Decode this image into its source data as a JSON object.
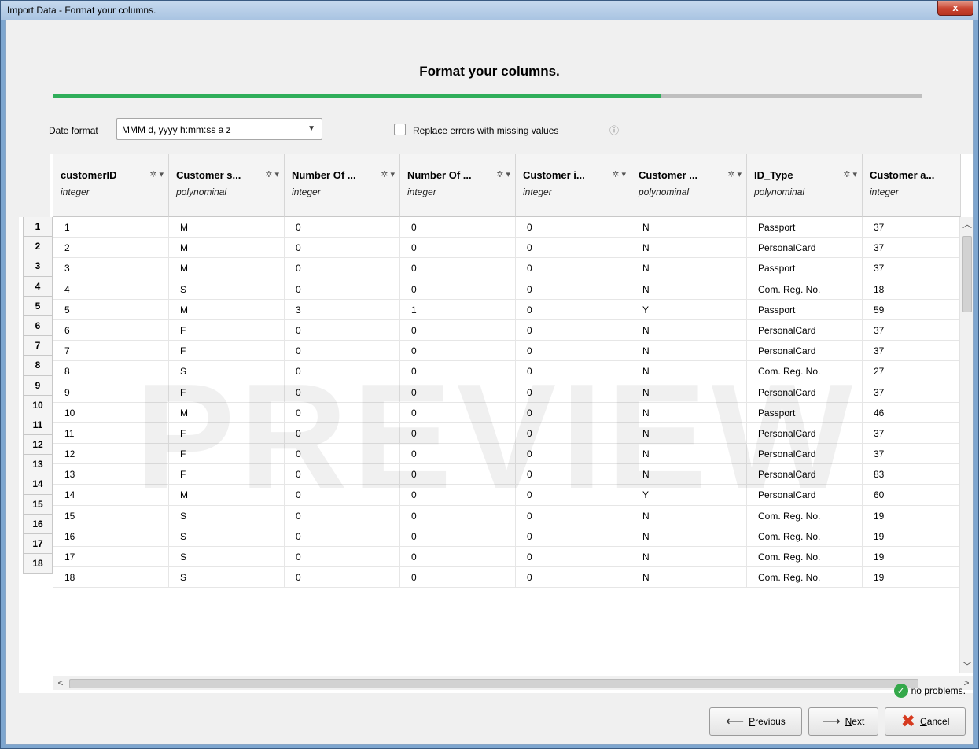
{
  "window": {
    "title": "Import Data - Format your columns.",
    "close_label": "x"
  },
  "heading": "Format your columns.",
  "progress": {
    "fraction": 0.7
  },
  "date_format": {
    "label_underlined": "D",
    "label_rest": "ate format",
    "value": "MMM d, yyyy h:mm:ss a z"
  },
  "replace_errors": {
    "label": "Replace errors with missing values",
    "checked": false,
    "info_icon": "info-icon"
  },
  "columns": [
    {
      "name": "customerID",
      "type": "integer"
    },
    {
      "name": "Customer s...",
      "type": "polynominal"
    },
    {
      "name": "Number Of ...",
      "type": "integer"
    },
    {
      "name": "Number Of ...",
      "type": "integer"
    },
    {
      "name": "Customer i...",
      "type": "integer"
    },
    {
      "name": "Customer ...",
      "type": "polynominal"
    },
    {
      "name": "ID_Type",
      "type": "polynominal"
    },
    {
      "name": "Customer a...",
      "type": "integer"
    }
  ],
  "rows": [
    [
      "1",
      "M",
      "0",
      "0",
      "0",
      "N",
      "Passport",
      "37"
    ],
    [
      "2",
      "M",
      "0",
      "0",
      "0",
      "N",
      "PersonalCard",
      "37"
    ],
    [
      "3",
      "M",
      "0",
      "0",
      "0",
      "N",
      "Passport",
      "37"
    ],
    [
      "4",
      "S",
      "0",
      "0",
      "0",
      "N",
      "Com. Reg. No.",
      "18"
    ],
    [
      "5",
      "M",
      "3",
      "1",
      "0",
      "Y",
      "Passport",
      "59"
    ],
    [
      "6",
      "F",
      "0",
      "0",
      "0",
      "N",
      "PersonalCard",
      "37"
    ],
    [
      "7",
      "F",
      "0",
      "0",
      "0",
      "N",
      "PersonalCard",
      "37"
    ],
    [
      "8",
      "S",
      "0",
      "0",
      "0",
      "N",
      "Com. Reg. No.",
      "27"
    ],
    [
      "9",
      "F",
      "0",
      "0",
      "0",
      "N",
      "PersonalCard",
      "37"
    ],
    [
      "10",
      "M",
      "0",
      "0",
      "0",
      "N",
      "Passport",
      "46"
    ],
    [
      "11",
      "F",
      "0",
      "0",
      "0",
      "N",
      "PersonalCard",
      "37"
    ],
    [
      "12",
      "F",
      "0",
      "0",
      "0",
      "N",
      "PersonalCard",
      "37"
    ],
    [
      "13",
      "F",
      "0",
      "0",
      "0",
      "N",
      "PersonalCard",
      "83"
    ],
    [
      "14",
      "M",
      "0",
      "0",
      "0",
      "Y",
      "PersonalCard",
      "60"
    ],
    [
      "15",
      "S",
      "0",
      "0",
      "0",
      "N",
      "Com. Reg. No.",
      "19"
    ],
    [
      "16",
      "S",
      "0",
      "0",
      "0",
      "N",
      "Com. Reg. No.",
      "19"
    ],
    [
      "17",
      "S",
      "0",
      "0",
      "0",
      "N",
      "Com. Reg. No.",
      "19"
    ],
    [
      "18",
      "S",
      "0",
      "0",
      "0",
      "N",
      "Com. Reg. No.",
      "19"
    ]
  ],
  "row_numbers": [
    "1",
    "2",
    "3",
    "4",
    "5",
    "6",
    "7",
    "8",
    "9",
    "10",
    "11",
    "12",
    "13",
    "14",
    "15",
    "16",
    "17",
    "18"
  ],
  "watermark": "PREVIEW",
  "status": {
    "text": "no problems.",
    "icon": "check-circle-icon"
  },
  "buttons": {
    "previous": {
      "underlined": "P",
      "rest": "revious",
      "icon": "arrow-left-icon"
    },
    "next": {
      "underlined": "N",
      "rest": "ext",
      "icon": "arrow-right-icon"
    },
    "cancel": {
      "underlined": "C",
      "rest": "ancel",
      "icon": "red-x-icon"
    }
  },
  "colors": {
    "progress": "#2fae5a",
    "ok": "#34a84a",
    "cancel_x": "#d63a1f"
  }
}
